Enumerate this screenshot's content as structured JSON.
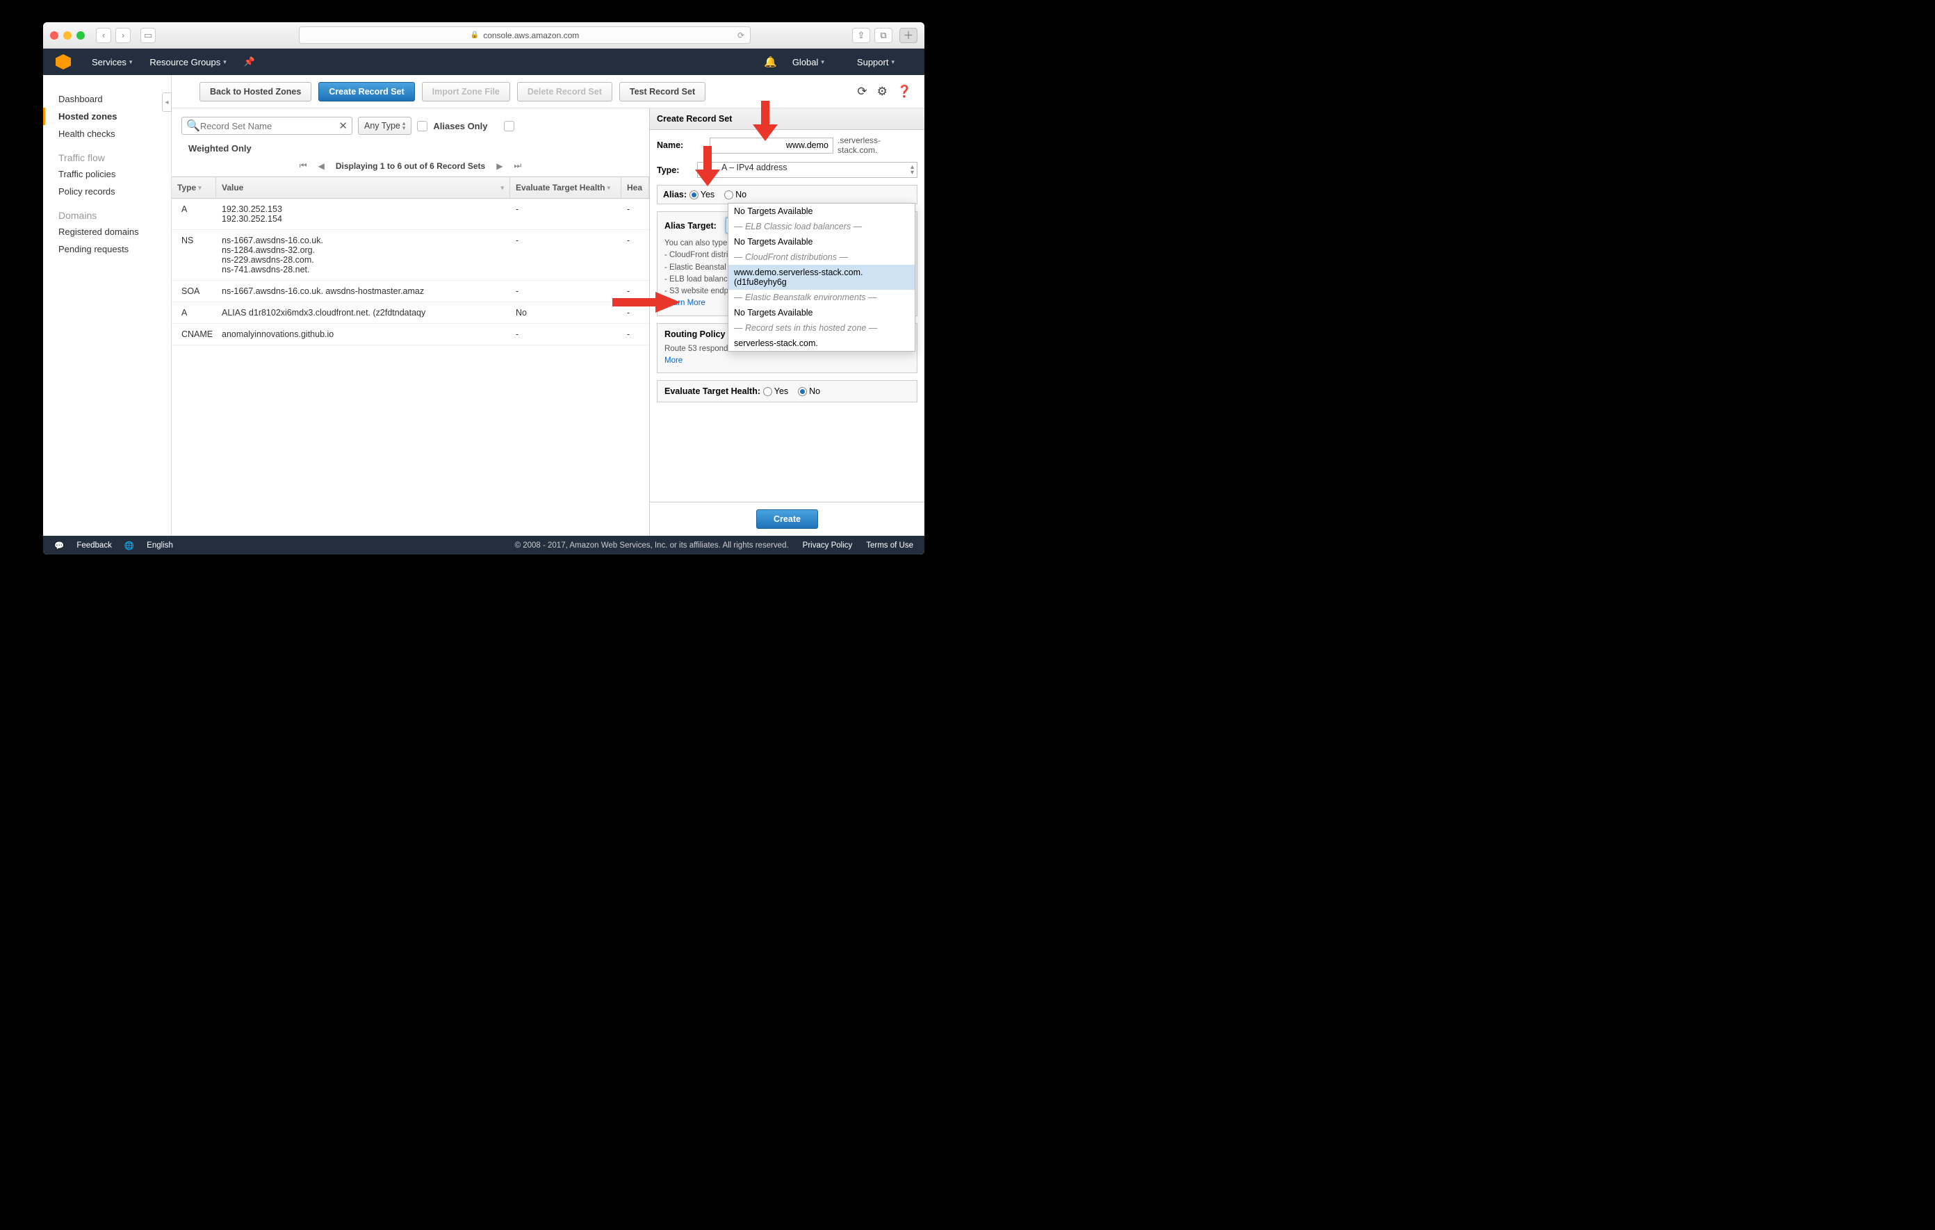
{
  "browser": {
    "url": "console.aws.amazon.com"
  },
  "nav": {
    "services": "Services",
    "resource_groups": "Resource Groups",
    "global": "Global",
    "support": "Support"
  },
  "sidebar": {
    "dashboard": "Dashboard",
    "hosted_zones": "Hosted zones",
    "health_checks": "Health checks",
    "traffic_flow": "Traffic flow",
    "traffic_policies": "Traffic policies",
    "policy_records": "Policy records",
    "domains": "Domains",
    "registered_domains": "Registered domains",
    "pending_requests": "Pending requests"
  },
  "actions": {
    "back": "Back to Hosted Zones",
    "create": "Create Record Set",
    "import": "Import Zone File",
    "delete": "Delete Record Set",
    "test": "Test Record Set"
  },
  "filter": {
    "search_placeholder": "Record Set Name",
    "any_type": "Any Type",
    "aliases_only": "Aliases Only",
    "weighted_only": "Weighted Only",
    "pager": "Displaying 1 to 6 out of 6 Record Sets"
  },
  "columns": {
    "type": "Type",
    "value": "Value",
    "eth": "Evaluate Target Health",
    "hea": "Hea"
  },
  "rows": [
    {
      "type": "A",
      "value": "192.30.252.153\n192.30.252.154",
      "eth": "-",
      "hea": "-"
    },
    {
      "type": "NS",
      "value": "ns-1667.awsdns-16.co.uk.\nns-1284.awsdns-32.org.\nns-229.awsdns-28.com.\nns-741.awsdns-28.net.",
      "eth": "-",
      "hea": "-"
    },
    {
      "type": "SOA",
      "value": "ns-1667.awsdns-16.co.uk. awsdns-hostmaster.amaz",
      "eth": "-",
      "hea": "-"
    },
    {
      "type": "A",
      "value": "ALIAS d1r8102xi6mdx3.cloudfront.net. (z2fdtndataqy",
      "eth": "No",
      "hea": "-"
    },
    {
      "type": "CNAME",
      "value": "anomalyinnovations.github.io",
      "eth": "-",
      "hea": "-"
    }
  ],
  "panel": {
    "title": "Create Record Set",
    "name_label": "Name:",
    "name_value": "www.demo",
    "name_suffix": ".serverless-stack.com.",
    "type_label": "Type:",
    "type_value": "A – IPv4 address",
    "alias_label": "Alias:",
    "alias_yes": "Yes",
    "alias_no": "No",
    "alias_target_label": "Alias Target:",
    "hint_intro": "You can also type",
    "hint_bullets": [
      "- CloudFront distri",
      "- Elastic Beanstal",
      "- ELB load balanc",
      "- S3 website endp"
    ],
    "learn_more": "Learn More",
    "routing_label": "Routing Policy",
    "routing_hint": "Route 53 responds",
    "routing_more": "More",
    "eth_label": "Evaluate Target Health:",
    "eth_yes": "Yes",
    "eth_no": "No",
    "create_btn": "Create"
  },
  "dropdown": {
    "nta": "No Targets Available",
    "g1": "— ELB Classic load balancers —",
    "g2": "— CloudFront distributions —",
    "target": "www.demo.serverless-stack.com. (d1fu8eyhy6g",
    "g3": "— Elastic Beanstalk environments —",
    "g4": "— Record sets in this hosted zone —",
    "zone": "serverless-stack.com."
  },
  "footer": {
    "feedback": "Feedback",
    "english": "English",
    "copyright": "© 2008 - 2017, Amazon Web Services, Inc. or its affiliates. All rights reserved.",
    "privacy": "Privacy Policy",
    "terms": "Terms of Use"
  }
}
